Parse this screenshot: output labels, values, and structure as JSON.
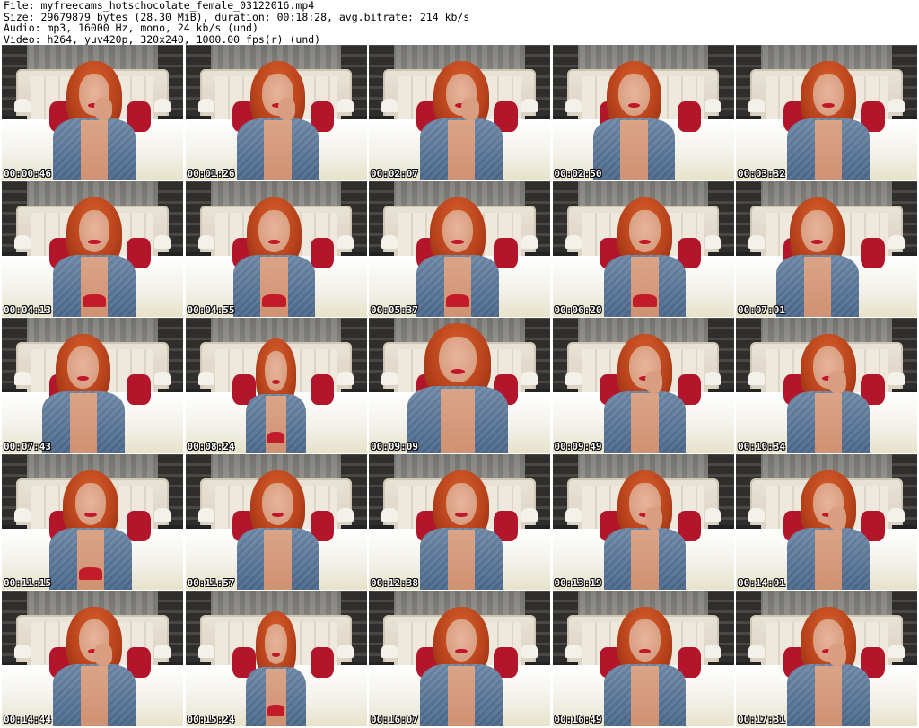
{
  "header": {
    "file_line": "File: myfreecams_hotschocolate_female_03122016.mp4",
    "size_line": "Size: 29679879 bytes (28.30 MiB), duration: 00:18:28, avg.bitrate: 214 kb/s",
    "audio_line": "Audio: mp3, 16000 Hz, mono, 24 kb/s (und)",
    "video_line": "Video: h264, yuv420p, 320x240, 1000.00 fps(r) (und)"
  },
  "thumbnails": [
    {
      "timestamp": "00:00:46",
      "pose": "hand-chin"
    },
    {
      "timestamp": "00:01:26",
      "pose": "hand-chin"
    },
    {
      "timestamp": "00:02:07",
      "pose": "hand-chin"
    },
    {
      "timestamp": "00:02:50",
      "pose": "lean"
    },
    {
      "timestamp": "00:03:32",
      "pose": "smile"
    },
    {
      "timestamp": "00:04:13",
      "pose": "smile"
    },
    {
      "timestamp": "00:04:55",
      "pose": "look-down"
    },
    {
      "timestamp": "00:05:37",
      "pose": "look-down"
    },
    {
      "timestamp": "00:06:20",
      "pose": "smile"
    },
    {
      "timestamp": "00:07:01",
      "pose": "lean"
    },
    {
      "timestamp": "00:07:43",
      "pose": "lean"
    },
    {
      "timestamp": "00:08:24",
      "pose": "full-body"
    },
    {
      "timestamp": "00:09:09",
      "pose": "close-up"
    },
    {
      "timestamp": "00:09:49",
      "pose": "hand-chin"
    },
    {
      "timestamp": "00:10:34",
      "pose": "hand-chin"
    },
    {
      "timestamp": "00:11:15",
      "pose": "look-down"
    },
    {
      "timestamp": "00:11:57",
      "pose": "smile"
    },
    {
      "timestamp": "00:12:38",
      "pose": "smile"
    },
    {
      "timestamp": "00:13:19",
      "pose": "hand-chin"
    },
    {
      "timestamp": "00:14:01",
      "pose": "hand-chin"
    },
    {
      "timestamp": "00:14:44",
      "pose": "hand-chin"
    },
    {
      "timestamp": "00:15:24",
      "pose": "full-body"
    },
    {
      "timestamp": "00:16:07",
      "pose": "smile"
    },
    {
      "timestamp": "00:16:49",
      "pose": "smile"
    },
    {
      "timestamp": "00:17:31",
      "pose": "hand-chin"
    }
  ],
  "colors": {
    "timestamp_text": "#ffffff",
    "timestamp_outline": "#000000",
    "hair": "#c24e20",
    "vest_denim": "#5a7698",
    "accent_red": "#c21c2a"
  }
}
